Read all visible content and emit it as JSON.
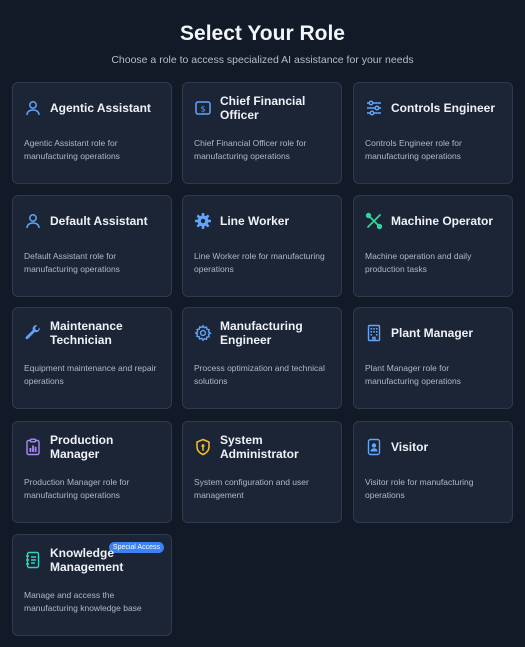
{
  "header": {
    "title": "Select Your Role",
    "subtitle": "Choose a role to access specialized AI assistance for your needs"
  },
  "roles": [
    {
      "name": "Agentic Assistant",
      "description": "Agentic Assistant role for manufacturing operations",
      "icon": "user-icon"
    },
    {
      "name": "Chief Financial Officer",
      "description": "Chief Financial Officer role for manufacturing operations",
      "icon": "finance-icon"
    },
    {
      "name": "Controls Engineer",
      "description": "Controls Engineer role for manufacturing operations",
      "icon": "sliders-icon"
    },
    {
      "name": "Default Assistant",
      "description": "Default Assistant role for manufacturing operations",
      "icon": "user-icon"
    },
    {
      "name": "Line Worker",
      "description": "Line Worker role for manufacturing operations",
      "icon": "gear-icon"
    },
    {
      "name": "Machine Operator",
      "description": "Machine operation and daily production tasks",
      "icon": "tools-icon"
    },
    {
      "name": "Maintenance Technician",
      "description": "Equipment maintenance and repair operations",
      "icon": "wrench-icon"
    },
    {
      "name": "Manufacturing Engineer",
      "description": "Process optimization and technical solutions",
      "icon": "cog-outline-icon"
    },
    {
      "name": "Plant Manager",
      "description": "Plant Manager role for manufacturing operations",
      "icon": "building-icon"
    },
    {
      "name": "Production Manager",
      "description": "Production Manager role for manufacturing operations",
      "icon": "clipboard-chart-icon"
    },
    {
      "name": "System Administrator",
      "description": "System configuration and user management",
      "icon": "shield-icon"
    },
    {
      "name": "Visitor",
      "description": "Visitor role for manufacturing operations",
      "icon": "badge-icon"
    },
    {
      "name": "Knowledge Management",
      "description": "Manage and access the manufacturing knowledge base",
      "icon": "notebook-icon",
      "badge": "Special Access"
    }
  ],
  "colors": {
    "background": "#131a27",
    "card": "#1c2536",
    "accent": "#3b82f6",
    "icon_blue": "#60a5fa",
    "icon_green": "#34d399",
    "icon_purple": "#a78bfa",
    "icon_yellow": "#fbbf24",
    "icon_teal": "#2dd4bf"
  }
}
